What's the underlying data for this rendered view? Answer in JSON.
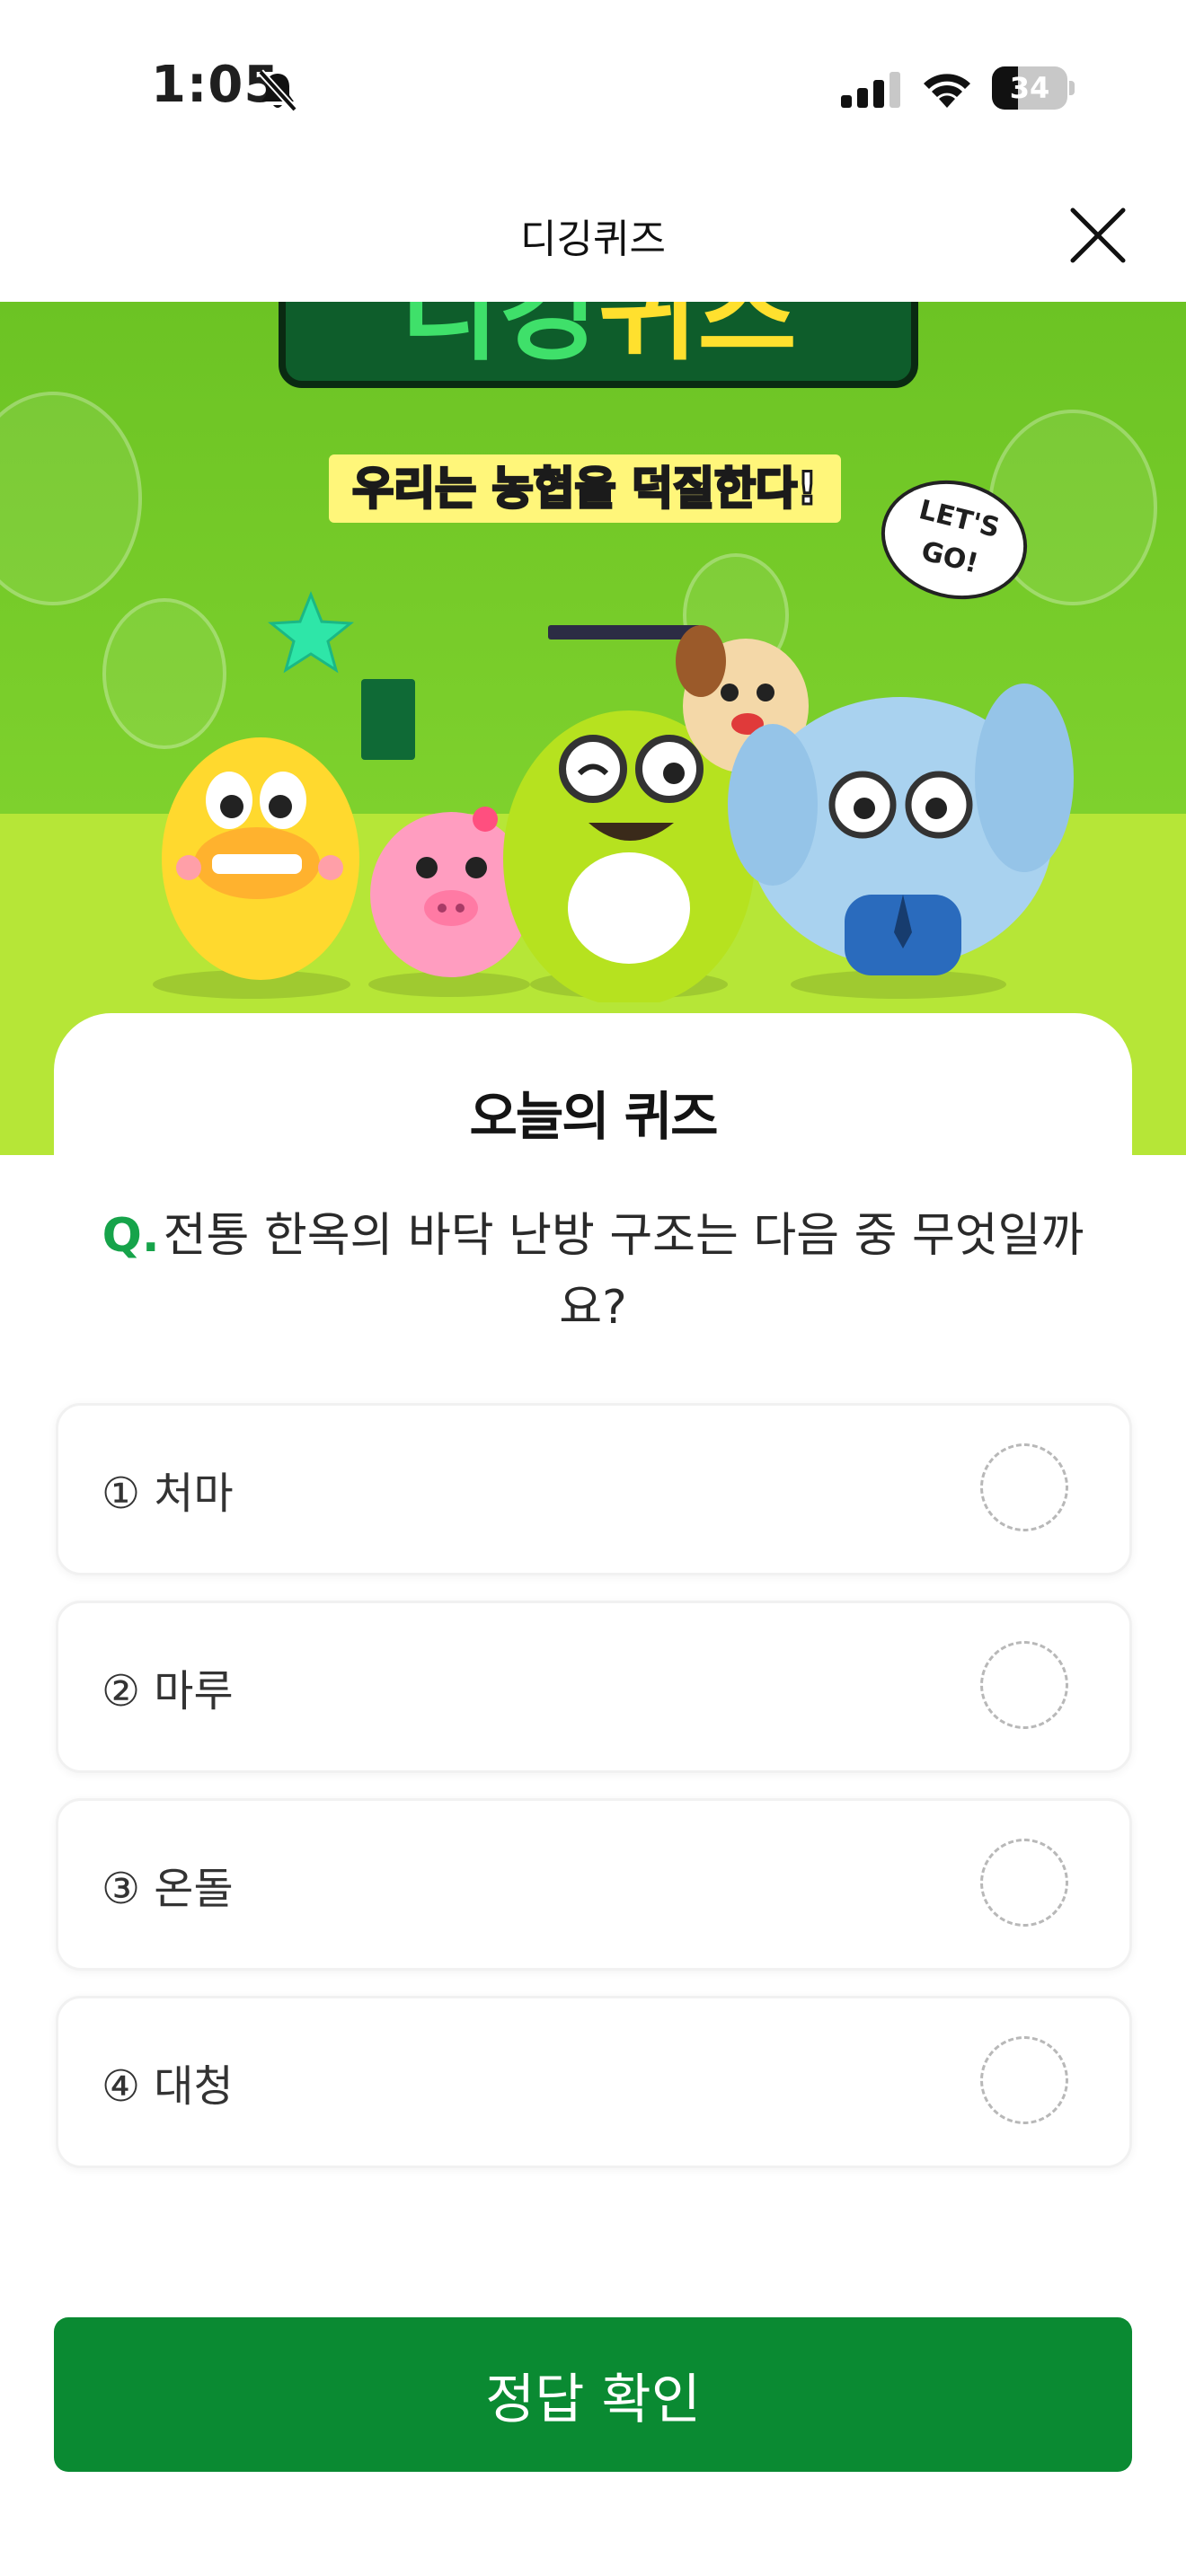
{
  "status_bar": {
    "time": "1:05",
    "battery_level": "34",
    "battery_fraction": 0.34
  },
  "header": {
    "title": "디깅퀴즈",
    "close_icon": "close-icon"
  },
  "banner": {
    "logo_text_left": "디깅",
    "logo_text_right": "퀴즈",
    "slogan": "우리는 농협을 덕질한다!",
    "speech_line1": "LET'S",
    "speech_line2": "GO!"
  },
  "quiz": {
    "card_title": "오늘의 퀴즈",
    "question_prefix": "Q.",
    "question": "전통 한옥의 바닥 난방 구조는 다음 중 무엇일까요?",
    "options": [
      {
        "label": "① 처마",
        "selected": false
      },
      {
        "label": "② 마루",
        "selected": false
      },
      {
        "label": "③ 온돌",
        "selected": false
      },
      {
        "label": "④ 대청",
        "selected": false
      }
    ],
    "submit_label": "정답 확인"
  },
  "colors": {
    "accent_green": "#0a8a32",
    "question_q": "#16a34a",
    "banner_green": "#7ed12d",
    "banner_lime": "#b6e637"
  }
}
